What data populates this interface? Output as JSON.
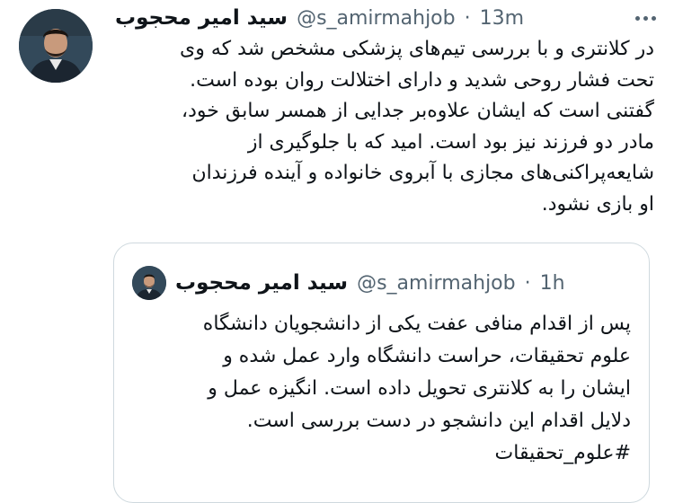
{
  "tweet": {
    "author_name": "سید امیر محجوب",
    "handle": "@s_amirmahjob",
    "separator": "·",
    "time": "13m",
    "text_lines": [
      "در کلانتری و با بررسی تیم‌های پزشکی مشخص شد که وی",
      "تحت فشار روحی شدید و دارای اختلالت روان بوده است.",
      "گفتنی است که ایشان علاوه‌بر جدایی از همسر سابق خود،",
      "مادر دو فرزند نیز بود است. امید که با جلوگیری از",
      "شایعه‌پراکنی‌های مجازی با آبروی خانواده و آینده فرزندان",
      "او بازی نشود."
    ]
  },
  "quoted": {
    "author_name": "سید امیر محجوب",
    "handle": "@s_amirmahjob",
    "separator": "·",
    "time": "1h",
    "text_lines": [
      "پس از اقدام منافی عفت یکی از دانشجویان دانشگاه",
      "علوم تحقیقات، حراست دانشگاه وارد عمل شده و",
      "ایشان را به کلانتری تحویل داده است. انگیزه عمل و",
      "دلایل اقدام این دانشجو در دست بررسی است."
    ],
    "hashtag": "#علوم_تحقیقات"
  },
  "icons": {
    "more": "more-horizontal-icon",
    "avatar": "profile-avatar"
  },
  "colors": {
    "text": "#0f1419",
    "secondary": "#536471",
    "border": "#cfd9de"
  }
}
